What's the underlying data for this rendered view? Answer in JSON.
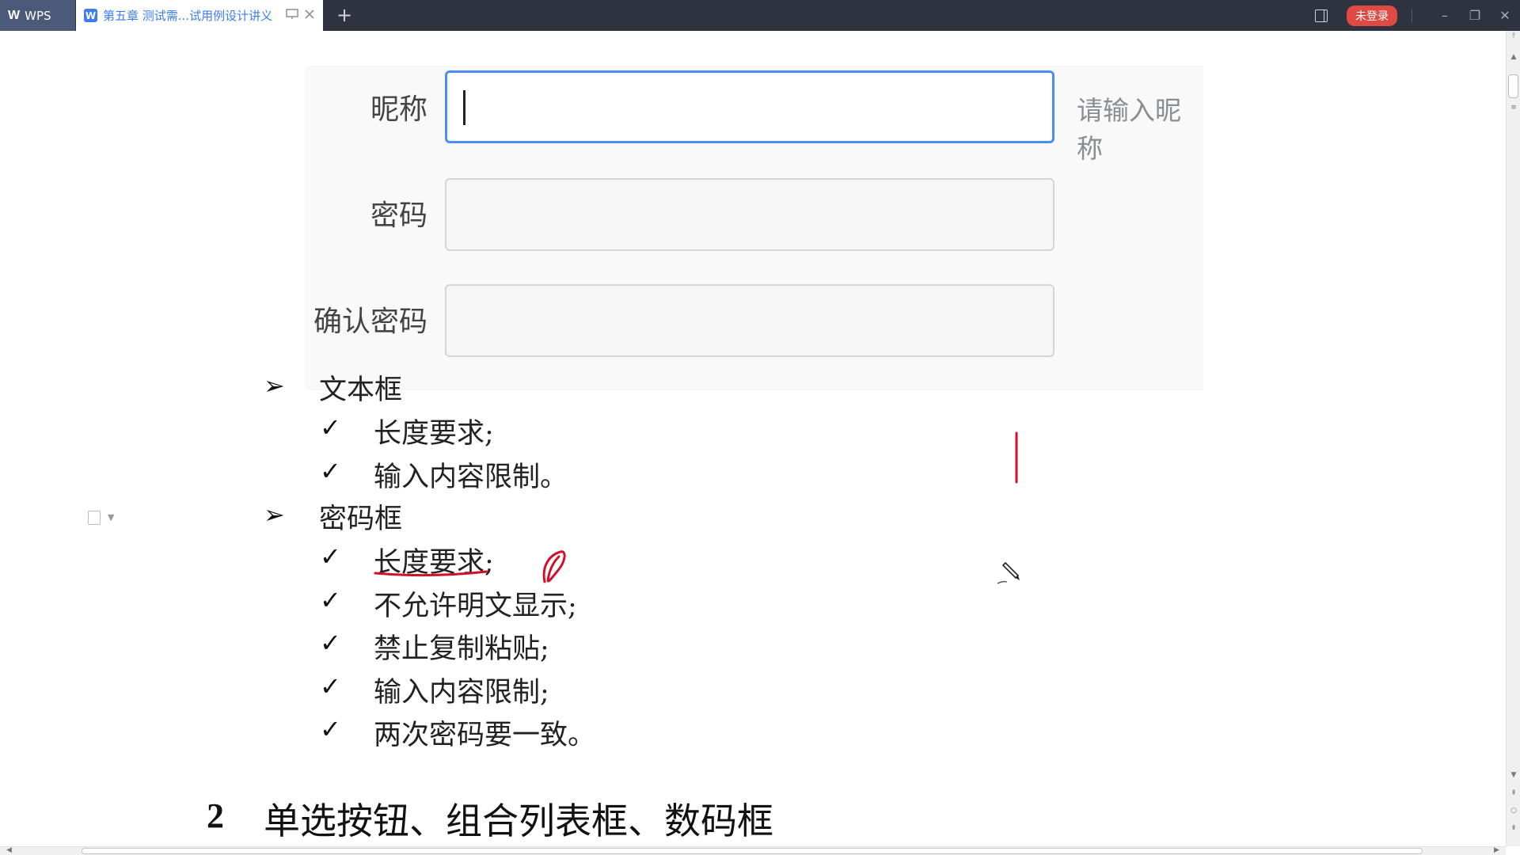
{
  "titlebar": {
    "app_label": "WPS",
    "doc_tab_title": "第五章 测试需...试用例设计讲义",
    "new_tab": "+",
    "login_label": "未登录",
    "min_glyph": "–",
    "restore_glyph": "❐",
    "close_glyph": "✕"
  },
  "form": {
    "nickname_label": "昵称",
    "nickname_hint": "请输入昵称",
    "password_label": "密码",
    "confirm_label": "确认密码"
  },
  "outline": {
    "arrow": "➢",
    "check": "✓",
    "textbox": {
      "title": "文本框",
      "items": [
        "长度要求;",
        "输入内容限制。"
      ]
    },
    "password": {
      "title": "密码框",
      "items": [
        "长度要求;",
        "不允许明文显示;",
        "禁止复制粘贴;",
        "输入内容限制;",
        "两次密码要一致。"
      ]
    }
  },
  "heading": {
    "number": "2",
    "text": "单选按钮、组合列表框、数码框"
  },
  "colors": {
    "titlebar_bg": "#2f3340",
    "accent_blue": "#3c7ef2",
    "login_red": "#e04a45",
    "annotation_red": "#d0112b"
  },
  "icons": [
    "wps-logo-icon",
    "doc-icon",
    "projector-icon",
    "close-icon",
    "panel-icon",
    "pen-cursor-icon"
  ]
}
